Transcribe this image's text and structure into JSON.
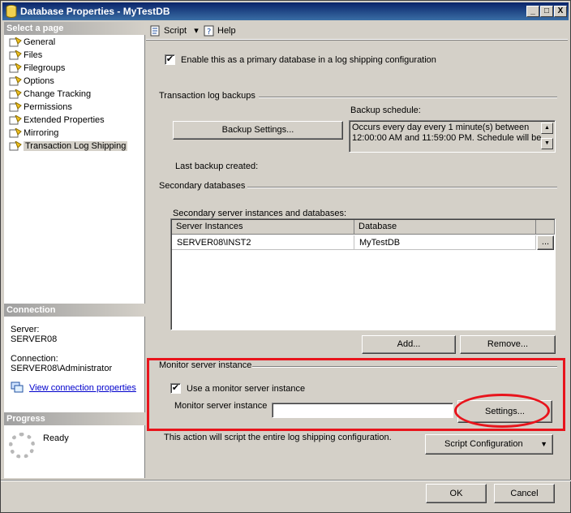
{
  "window": {
    "title": "Database Properties - MyTestDB",
    "min_label": "_",
    "max_label": "□",
    "close_label": "X"
  },
  "left": {
    "select_page_header": "Select a page",
    "pages": [
      {
        "label": "General"
      },
      {
        "label": "Files"
      },
      {
        "label": "Filegroups"
      },
      {
        "label": "Options"
      },
      {
        "label": "Change Tracking"
      },
      {
        "label": "Permissions"
      },
      {
        "label": "Extended Properties"
      },
      {
        "label": "Mirroring"
      },
      {
        "label": "Transaction Log Shipping",
        "selected": true
      }
    ],
    "connection_header": "Connection",
    "server_label": "Server:",
    "server_value": "SERVER08",
    "connection_label": "Connection:",
    "connection_value": "SERVER08\\Administrator",
    "view_link": "View connection properties",
    "progress_header": "Progress",
    "progress_status": "Ready"
  },
  "toolbar": {
    "script_label": "Script",
    "script_dropdown": "▾",
    "help_label": "Help"
  },
  "main": {
    "enable_primary_label": "Enable this as a primary database in a log shipping configuration",
    "enable_primary_checked": true,
    "check_mark": "✔",
    "tlog_section": "Transaction log backups",
    "backup_settings_button": "Backup Settings...",
    "backup_schedule_label": "Backup schedule:",
    "backup_schedule_text": "Occurs every day every 1 minute(s) between 12:00:00 AM and 11:59:00 PM. Schedule will be",
    "scroll_up": "▲",
    "scroll_down": "▼",
    "last_backup_label": "Last backup created:",
    "secondary_section": "Secondary databases",
    "secondary_instances_label": "Secondary server instances and databases:",
    "grid_columns": [
      "Server Instances",
      "Database"
    ],
    "grid_rows": [
      {
        "server": "SERVER08\\INST2",
        "database": "MyTestDB",
        "ellipsis": "..."
      }
    ],
    "add_button": "Add...",
    "remove_button": "Remove...",
    "monitor_section": "Monitor server instance",
    "use_monitor_label": "Use a monitor server instance",
    "use_monitor_checked": true,
    "monitor_instance_label": "Monitor server instance",
    "monitor_instance_value": "",
    "settings_button": "Settings...",
    "script_note": "This action will script the entire log shipping configuration.",
    "script_config_button": "Script Configuration",
    "script_config_arrow": "▼"
  },
  "footer": {
    "ok_button": "OK",
    "cancel_button": "Cancel"
  },
  "colors": {
    "highlight": "#e8141c",
    "title_start": "#0a246a",
    "title_end": "#3a6ea5",
    "face": "#d4d0c8"
  }
}
